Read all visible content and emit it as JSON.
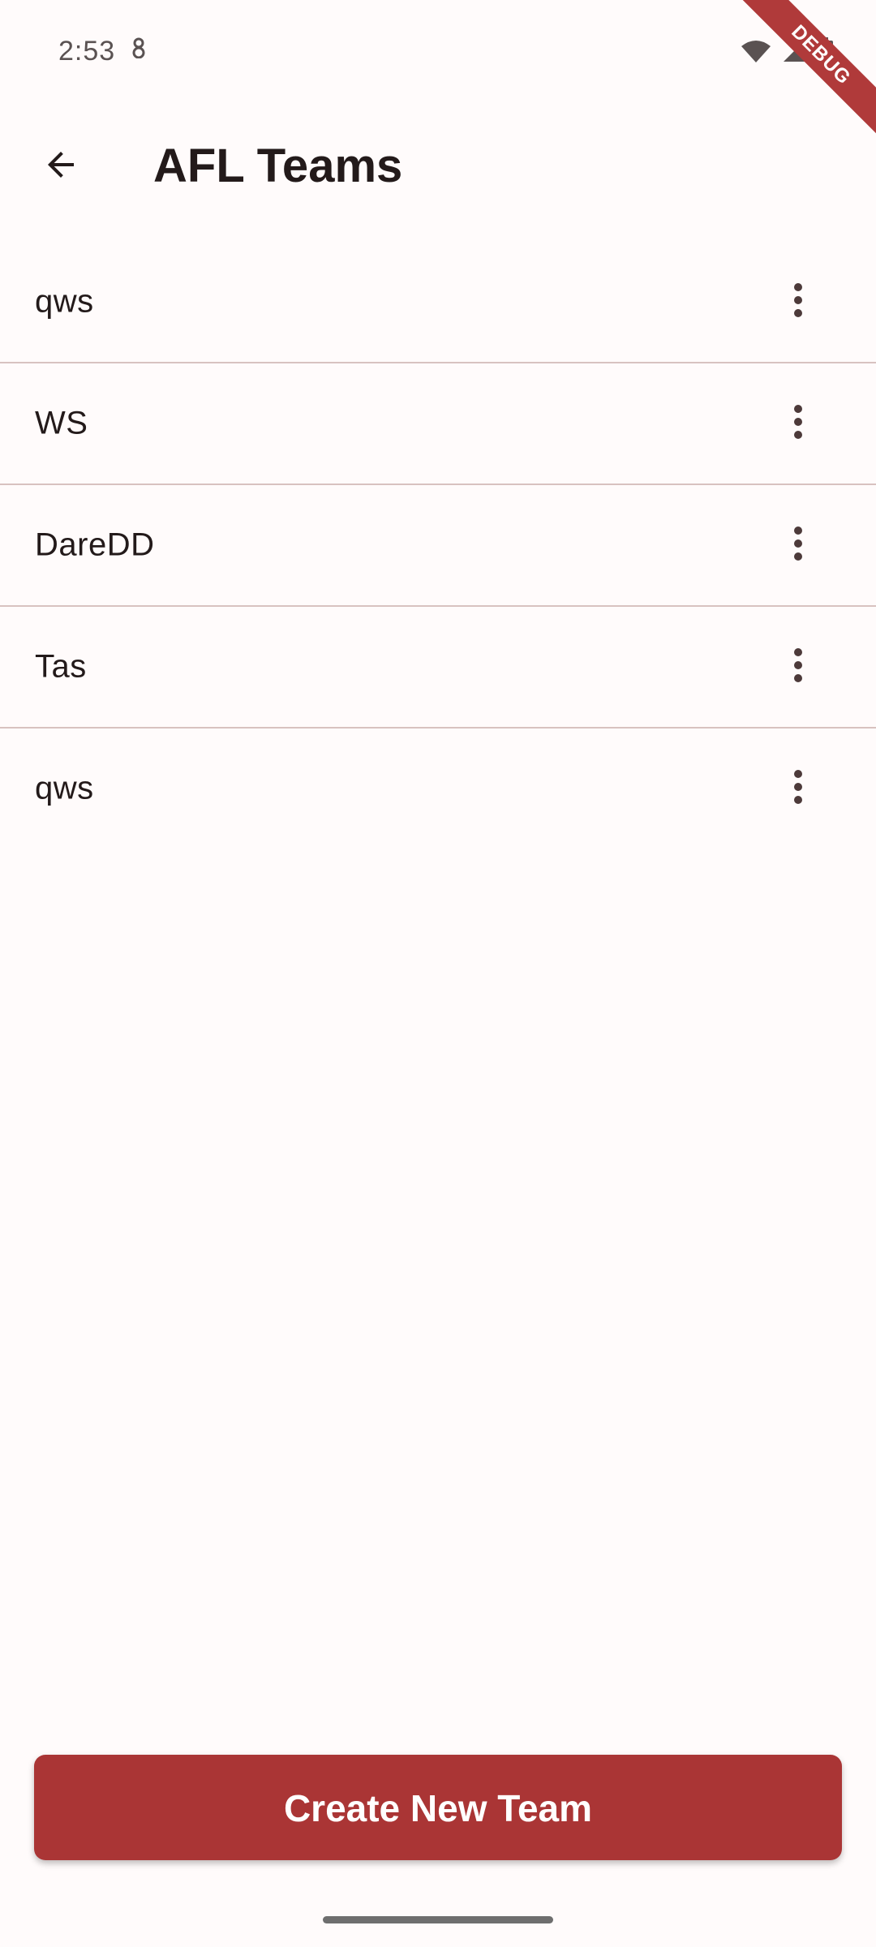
{
  "status_bar": {
    "time": "2:53"
  },
  "debug_banner": {
    "label": "DEBUG"
  },
  "app_bar": {
    "title": "AFL Teams",
    "back_icon": "arrow-back-icon"
  },
  "teams": [
    {
      "name": "qws"
    },
    {
      "name": "WS"
    },
    {
      "name": "DareDD"
    },
    {
      "name": "Tas"
    },
    {
      "name": "qws"
    }
  ],
  "item_menu_icon": "more-vert-icon",
  "actions": {
    "create_label": "Create New Team"
  },
  "colors": {
    "primary": "#aa3535",
    "divider": "#d8c2c0",
    "text": "#231a1a",
    "background": "#fffbfb"
  }
}
